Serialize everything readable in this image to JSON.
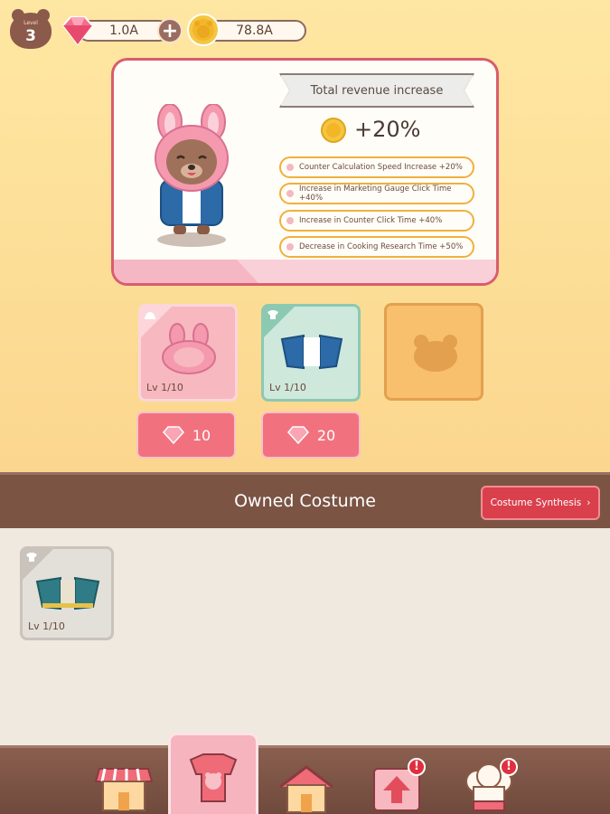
{
  "status": {
    "level_label": "Level",
    "level": "3",
    "gems": "1.0A",
    "coins": "78.8A"
  },
  "card": {
    "banner": "Total revenue increase",
    "revenue_bonus": "+20%",
    "effects": [
      "Counter Calculation Speed Increase +20%",
      "Increase in Marketing Gauge Click Time +40%",
      "Increase in Counter Click Time +40%",
      "Decrease in Cooking Research Time +50%"
    ]
  },
  "slots": [
    {
      "item": "bunny-hood",
      "level": "Lv 1/10",
      "price": "10"
    },
    {
      "item": "denim-jacket",
      "level": "Lv 1/10",
      "price": "20"
    },
    {
      "item": "empty",
      "level": "",
      "price": ""
    }
  ],
  "owned": {
    "title": "Owned Costume",
    "synth_button": "Costume Synthesis",
    "items": [
      {
        "item": "teal-jacket",
        "level": "Lv 1/10"
      }
    ]
  },
  "nav": {
    "tabs": [
      "shop-icon",
      "costume-icon",
      "home-icon",
      "upgrade-icon",
      "chef-hat-icon"
    ],
    "active": "costume-icon",
    "alerts": [
      "upgrade-icon",
      "chef-hat-icon"
    ],
    "alert_text": "!"
  },
  "colors": {
    "accent_pink": "#f1727e",
    "card_border": "#d85d6e",
    "brown": "#7b5444",
    "gold": "#f0b03c"
  }
}
